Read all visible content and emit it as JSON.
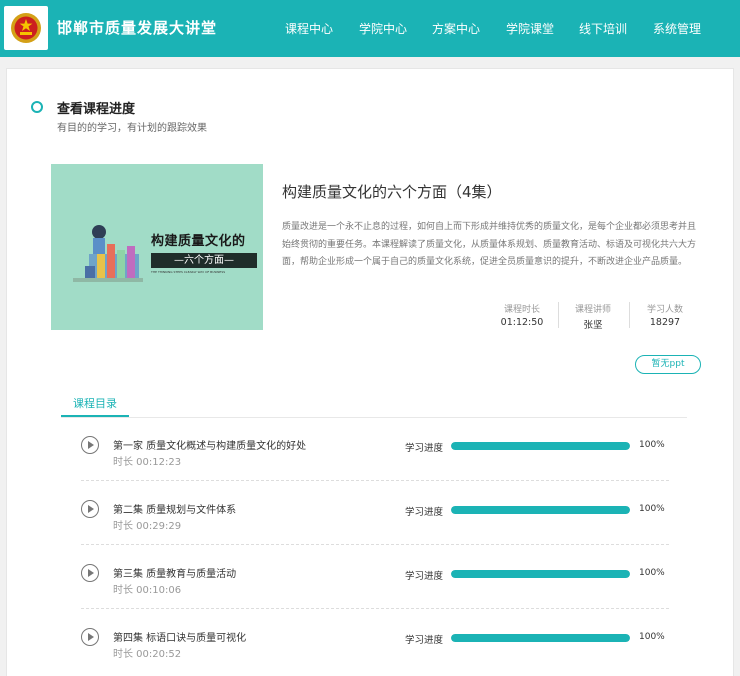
{
  "header": {
    "site_title": "邯郸市质量发展大讲堂",
    "nav": [
      "课程中心",
      "学院中心",
      "方案中心",
      "学院课堂",
      "线下培训",
      "系统管理"
    ]
  },
  "section": {
    "title": "查看课程进度",
    "subtitle": "有目的的学习，有计划的跟踪效果"
  },
  "course": {
    "cover_title": "构建质量文化的",
    "cover_subtitle": "—六个方面—",
    "cover_english": "THE THINKING STEPS CLEARLY WAY OF BUSINESS",
    "title": "构建质量文化的六个方面（4集）",
    "description": "质量改进是一个永不止息的过程，如何自上而下形成并维持优秀的质量文化，是每个企业都必须思考并且始终贯彻的重要任务。本课程解读了质量文化，从质量体系规划、质量教育活动、标语及可视化共六大方面，帮助企业形成一个属于自己的质量文化系统，促进全员质量意识的提升，不断改进企业产品质量。",
    "stats": [
      {
        "label": "课程时长",
        "value": "01:12:50"
      },
      {
        "label": "课程讲师",
        "value": "张坚"
      },
      {
        "label": "学习人数",
        "value": "18297"
      }
    ],
    "ppt_button": "暂无ppt"
  },
  "tab": "课程目录",
  "episodes": [
    {
      "title": "第一家 质量文化概述与构建质量文化的好处",
      "duration": "时长 00:12:23",
      "progress_label": "学习进度",
      "progress": 100,
      "progress_text": "100%"
    },
    {
      "title": "第二集 质量规划与文件体系",
      "duration": "时长 00:29:29",
      "progress_label": "学习进度",
      "progress": 100,
      "progress_text": "100%"
    },
    {
      "title": "第三集 质量教育与质量活动",
      "duration": "时长 00:10:06",
      "progress_label": "学习进度",
      "progress": 100,
      "progress_text": "100%"
    },
    {
      "title": "第四集 标语口诀与质量可视化",
      "duration": "时长 00:20:52",
      "progress_label": "学习进度",
      "progress": 100,
      "progress_text": "100%"
    }
  ],
  "colors": {
    "accent": "#1bb3b5",
    "cover_bg": "#a1dcc7"
  }
}
